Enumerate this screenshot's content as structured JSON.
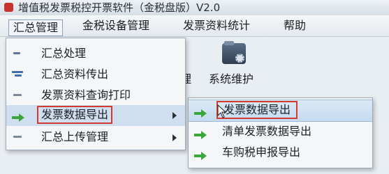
{
  "window": {
    "title": "增值税发票税控开票软件（金税盘版）V2.0"
  },
  "menubar": {
    "items": [
      {
        "label": "汇总管理"
      },
      {
        "label": "金税设备管理"
      },
      {
        "label": "发票资料统计"
      },
      {
        "label": "帮助"
      }
    ]
  },
  "toolbar": {
    "partial_label": "理",
    "system_maintenance_label": "系统维护"
  },
  "dropdown": {
    "items": [
      {
        "label": "汇总处理",
        "icon": "summary-icon"
      },
      {
        "label": "汇总资料传出",
        "icon": "export-data-icon"
      },
      {
        "label": "发票资料查询打印",
        "icon": "print-query-icon"
      },
      {
        "label": "发票数据导出",
        "icon": "green-arrow-icon"
      },
      {
        "label": "汇总上传管理",
        "icon": "upload-icon"
      }
    ]
  },
  "submenu": {
    "items": [
      {
        "label": "发票数据导出",
        "icon": "green-arrow-icon"
      },
      {
        "label": "清单发票数据导出",
        "icon": "green-arrow-icon"
      },
      {
        "label": "车购税申报导出",
        "icon": "green-arrow-icon"
      }
    ]
  },
  "colors": {
    "highlight_box": "#d23a2e",
    "arrow_green": "#3aa63a"
  }
}
